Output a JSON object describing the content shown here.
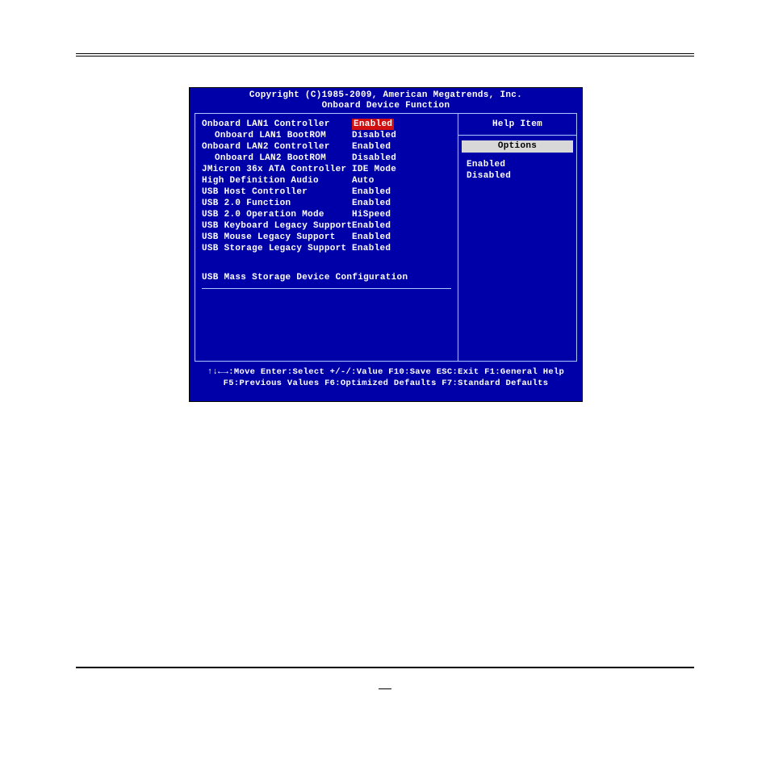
{
  "header": {
    "copyright": "Copyright (C)1985-2009, American Megatrends, Inc.",
    "title": "Onboard Device Function"
  },
  "settings": [
    {
      "label": "Onboard LAN1 Controller",
      "value": "Enabled",
      "indent": false,
      "selected": true
    },
    {
      "label": "Onboard LAN1 BootROM",
      "value": "Disabled",
      "indent": true,
      "selected": false
    },
    {
      "label": "Onboard LAN2 Controller",
      "value": "Enabled",
      "indent": false,
      "selected": false
    },
    {
      "label": "Onboard LAN2 BootROM",
      "value": "Disabled",
      "indent": true,
      "selected": false
    },
    {
      "label": "JMicron 36x ATA Controller",
      "value": "IDE Mode",
      "indent": false,
      "selected": false
    },
    {
      "label": "High Definition Audio",
      "value": "Auto",
      "indent": false,
      "selected": false
    },
    {
      "label": "USB Host Controller",
      "value": "Enabled",
      "indent": false,
      "selected": false
    },
    {
      "label": "USB 2.0 Function",
      "value": "Enabled",
      "indent": false,
      "selected": false
    },
    {
      "label": "USB 2.0 Operation Mode",
      "value": "HiSpeed",
      "indent": false,
      "selected": false
    },
    {
      "label": "USB Keyboard Legacy Support",
      "value": "Enabled",
      "indent": false,
      "selected": false
    },
    {
      "label": "USB Mouse Legacy Support",
      "value": "Enabled",
      "indent": false,
      "selected": false
    },
    {
      "label": "USB Storage Legacy Support",
      "value": "Enabled",
      "indent": false,
      "selected": false
    }
  ],
  "submenu": {
    "mass_storage": "USB Mass Storage Device Configuration"
  },
  "help": {
    "title": "Help Item",
    "options_label": "Options",
    "options": [
      "Enabled",
      "Disabled"
    ]
  },
  "footer": {
    "line1": "↑↓←→:Move  Enter:Select  +/-/:Value  F10:Save  ESC:Exit  F1:General Help",
    "line2": "F5:Previous Values    F6:Optimized Defaults    F7:Standard Defaults"
  }
}
